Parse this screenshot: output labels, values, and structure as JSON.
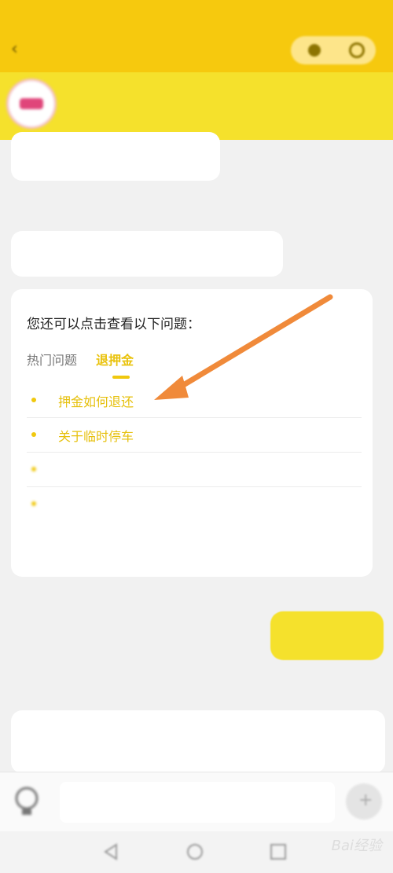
{
  "status_bar": {
    "left": "",
    "right": ""
  },
  "header": {
    "title": "",
    "back_icon": "chevron-left-icon",
    "menu_icon": "more-icon",
    "close_icon": "close-icon"
  },
  "merchant": {
    "name": "",
    "subtitle": ""
  },
  "messages": [
    {
      "from": "agent",
      "text": ""
    },
    {
      "from": "agent_label",
      "text": ""
    },
    {
      "from": "agent",
      "text": ""
    }
  ],
  "faq": {
    "heading": "您还可以点击查看以下问题：",
    "tabs": [
      {
        "label": "热门问题",
        "active": false
      },
      {
        "label": "退押金",
        "active": true
      }
    ],
    "questions": [
      {
        "text": "押金如何退还"
      },
      {
        "text": "关于临时停车"
      },
      {
        "text": ""
      },
      {
        "text": ""
      }
    ],
    "pager": ""
  },
  "user_message": {
    "text": "",
    "status": ""
  },
  "agent_reply": {
    "label": "",
    "line1": "",
    "line2": ""
  },
  "input": {
    "placeholder": "",
    "send_icon": "send-icon",
    "assistant_icon": "lightbulb-icon"
  },
  "nav": {
    "back_icon": "nav-back-icon",
    "home_icon": "nav-home-icon",
    "recent_icon": "nav-recent-icon"
  },
  "watermark": "Bai经验",
  "colors": {
    "accent": "#f6c90e",
    "link": "#e6c00c",
    "arrow": "#f08a3a"
  }
}
